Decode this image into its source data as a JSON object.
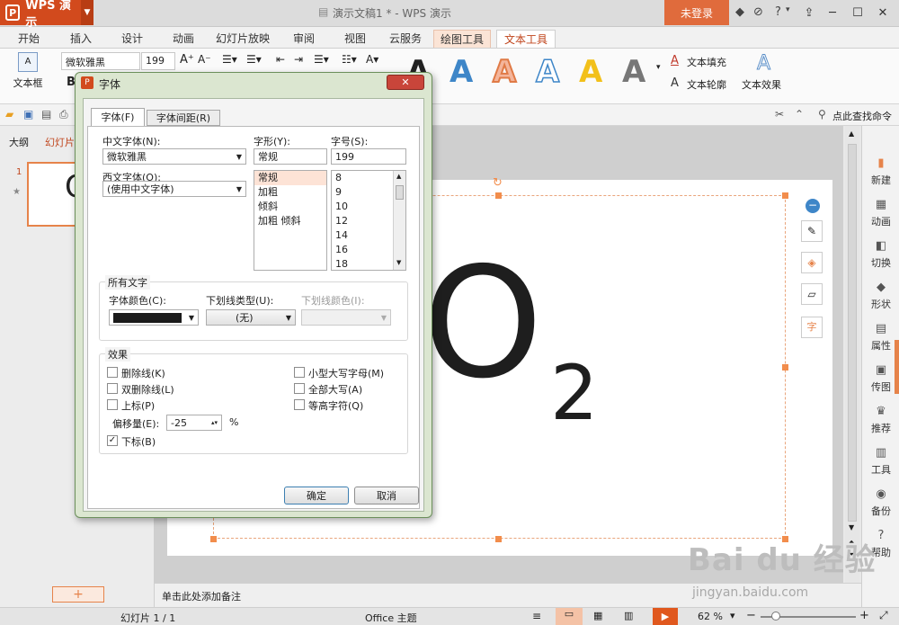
{
  "titlebar": {
    "app_name": "WPS 演示",
    "doc_title": "演示文稿1 * - WPS 演示",
    "login_label": "未登录"
  },
  "tabs": [
    "开始",
    "插入",
    "设计",
    "动画",
    "幻灯片放映",
    "审阅",
    "视图",
    "云服务",
    "绘图工具",
    "文本工具"
  ],
  "ribbon": {
    "textbox_label": "文本框",
    "font_name": "微软雅黑",
    "font_size": "199",
    "text_fill": "文本填充",
    "text_outline": "文本轮廓",
    "text_effect": "文本效果",
    "style_letter": "A"
  },
  "quickbar": {
    "search_label": "点此查找命令"
  },
  "leftpanel": {
    "tab_outline": "大纲",
    "tab_slides": "幻灯片",
    "slide_number": "1",
    "thumb_text": "O",
    "add_label": "+"
  },
  "slide": {
    "main_text": "O",
    "subscript_text": "2",
    "notes_placeholder": "单击此处添加备注"
  },
  "rightpanel": [
    "新建",
    "动画",
    "切换",
    "形状",
    "属性",
    "传图",
    "推荐",
    "工具",
    "备份",
    "帮助"
  ],
  "statusbar": {
    "slide_info": "幻灯片 1 / 1",
    "theme": "Office 主题",
    "zoom": "62 %"
  },
  "dialog": {
    "title": "字体",
    "tabs": [
      "字体(F)",
      "字体间距(R)"
    ],
    "cn_font_label": "中文字体(N):",
    "cn_font_value": "微软雅黑",
    "west_font_label": "西文字体(O):",
    "west_font_value": "(使用中文字体)",
    "style_label": "字形(Y):",
    "style_value": "常规",
    "style_list": [
      "常规",
      "加粗",
      "倾斜",
      "加粗 倾斜"
    ],
    "size_label": "字号(S):",
    "size_value": "199",
    "size_list": [
      "8",
      "9",
      "10",
      "12",
      "14",
      "16",
      "18"
    ],
    "all_text_group": "所有文字",
    "color_label": "字体颜色(C):",
    "underline_type_label": "下划线类型(U):",
    "underline_type_value": "(无)",
    "underline_color_label": "下划线颜色(I):",
    "effects_group": "效果",
    "effects": {
      "strikethrough": "删除线(K)",
      "double_strikethrough": "双删除线(L)",
      "superscript": "上标(P)",
      "small_caps": "小型大写字母(M)",
      "all_caps": "全部大写(A)",
      "equal_height": "等高字符(Q)",
      "subscript": "下标(B)"
    },
    "checked": {
      "subscript": true
    },
    "offset_label": "偏移量(E):",
    "offset_value": "-25",
    "offset_unit": "%",
    "ok_label": "确定",
    "cancel_label": "取消",
    "font_color": "#1a1a1a"
  },
  "watermark": {
    "brand": "Bai du 经验",
    "url": "jingyan.baidu.com"
  },
  "colors": {
    "accent": "#d24a1d",
    "text_tool_tab": "#c0451c"
  }
}
